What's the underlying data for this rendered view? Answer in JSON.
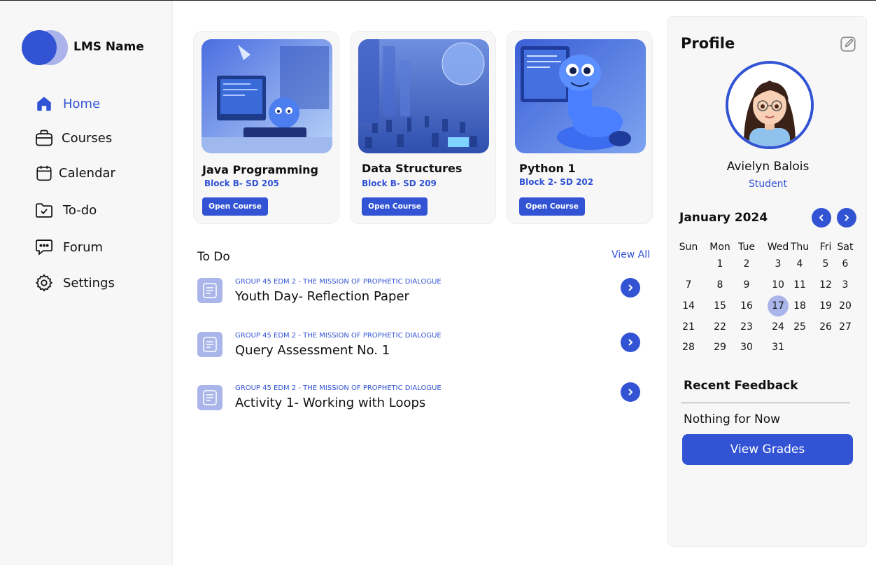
{
  "app": {
    "name": "LMS Name"
  },
  "sidebar": {
    "items": [
      {
        "label": "Home",
        "icon": "home-icon",
        "active": true
      },
      {
        "label": "Courses",
        "icon": "briefcase-icon"
      },
      {
        "label": "Calendar",
        "icon": "calendar-icon"
      },
      {
        "label": "To-do",
        "icon": "folder-check-icon"
      },
      {
        "label": "Forum",
        "icon": "chat-bubble-icon"
      },
      {
        "label": "Settings",
        "icon": "gear-icon"
      }
    ]
  },
  "courses": [
    {
      "title": "Java Programming",
      "block": "Block B- SD 205",
      "button": "Open Course"
    },
    {
      "title": "Data Structures",
      "block": "Block B- SD 209",
      "button": "Open Course"
    },
    {
      "title": "Python 1",
      "block": "Block 2- SD 202",
      "button": "Open Course"
    }
  ],
  "todo": {
    "title": "To Do",
    "view_all": "View All",
    "items": [
      {
        "group": "GROUP 45 EDM 2 - THE MISSION OF PROPHETIC DIALOGUE",
        "name": "Youth Day- Reflection Paper"
      },
      {
        "group": "GROUP 45 EDM 2 - THE MISSION OF PROPHETIC DIALOGUE",
        "name": "Query Assessment No. 1"
      },
      {
        "group": "GROUP 45 EDM 2 - THE MISSION OF PROPHETIC DIALOGUE",
        "name": "Activity 1- Working with Loops"
      }
    ]
  },
  "profile": {
    "title": "Profile",
    "name": "Avielyn Balois",
    "role": "Student"
  },
  "calendar": {
    "month": "January 2024",
    "weekdays": [
      "Sun",
      "Mon",
      "Tue",
      "Wed",
      "Thu",
      "Fri",
      "Sat"
    ],
    "weeks": [
      [
        "",
        "1",
        "2",
        "3",
        "4",
        "5",
        "6"
      ],
      [
        "7",
        "8",
        "9",
        "10",
        "11",
        "12",
        "3"
      ],
      [
        "14",
        "15",
        "16",
        "17",
        "18",
        "19",
        "20"
      ],
      [
        "21",
        "22",
        "23",
        "24",
        "25",
        "26",
        "27"
      ],
      [
        "28",
        "29",
        "30",
        "31",
        "",
        "",
        ""
      ]
    ],
    "selected": "17"
  },
  "feedback": {
    "title": "Recent Feedback",
    "empty": "Nothing for Now",
    "button": "View Grades"
  },
  "colors": {
    "accent": "#3153d4",
    "accent_light": "#aab6ea",
    "panel": "#f7f7f7"
  }
}
